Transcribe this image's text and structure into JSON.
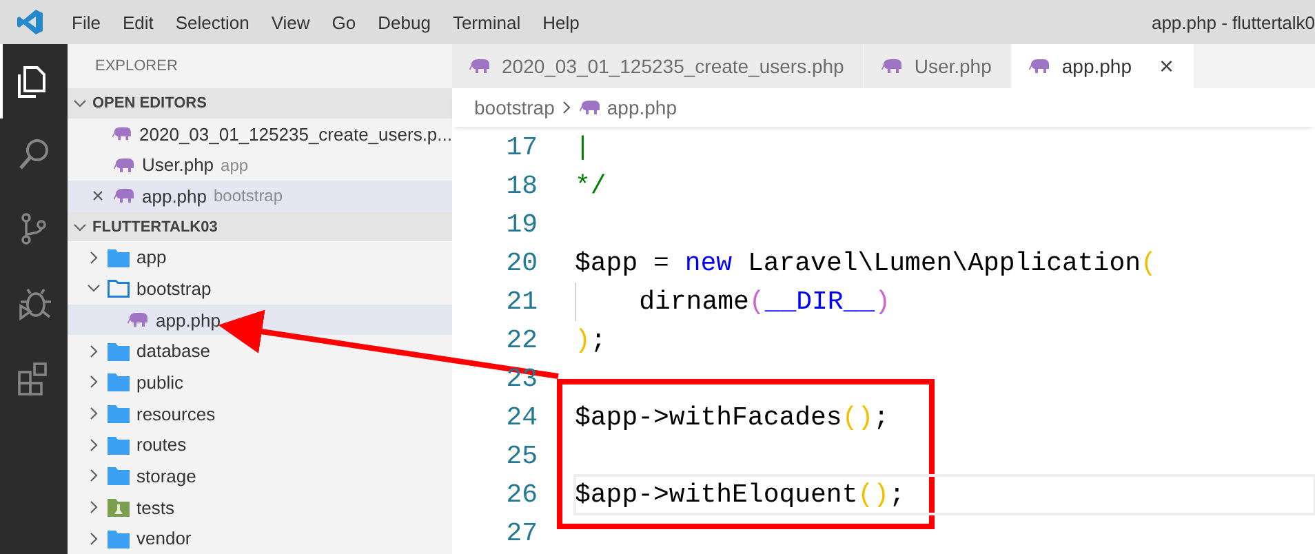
{
  "menu": [
    "File",
    "Edit",
    "Selection",
    "View",
    "Go",
    "Debug",
    "Terminal",
    "Help"
  ],
  "window": {
    "title": "app.php - fluttertalk0"
  },
  "activity_bar": [
    {
      "kind": "files",
      "selected": true
    },
    {
      "kind": "search",
      "selected": false
    },
    {
      "kind": "source-control",
      "selected": false
    },
    {
      "kind": "debug",
      "selected": false
    },
    {
      "kind": "extensions",
      "selected": false
    }
  ],
  "sidebar": {
    "title": "EXPLORER",
    "open_editors": {
      "label": "OPEN EDITORS",
      "expanded": true,
      "items": [
        {
          "label": "2020_03_01_125235_create_users.p...",
          "selected": false
        },
        {
          "label": "User.php",
          "description": "app",
          "selected": false
        },
        {
          "label": "app.php",
          "description": "bootstrap",
          "selected": true,
          "close": "×"
        }
      ]
    },
    "project": {
      "label": "FLUTTERTALK03",
      "expanded": true,
      "items": [
        {
          "label": "app",
          "kind": "folder",
          "expanded": false,
          "selected": false
        },
        {
          "label": "bootstrap",
          "kind": "folder",
          "expanded": true,
          "selected": false,
          "children": [
            {
              "label": "app.php",
              "kind": "php",
              "selected": true
            }
          ]
        },
        {
          "label": "database",
          "kind": "folder",
          "expanded": false,
          "selected": false
        },
        {
          "label": "public",
          "kind": "folder",
          "expanded": false,
          "selected": false
        },
        {
          "label": "resources",
          "kind": "folder",
          "expanded": false,
          "selected": false
        },
        {
          "label": "routes",
          "kind": "folder",
          "expanded": false,
          "selected": false
        },
        {
          "label": "storage",
          "kind": "folder",
          "expanded": false,
          "selected": false
        },
        {
          "label": "tests",
          "kind": "test-folder",
          "expanded": false,
          "selected": false
        },
        {
          "label": "vendor",
          "kind": "folder",
          "expanded": false,
          "selected": false
        }
      ]
    }
  },
  "tabs": [
    {
      "label": "2020_03_01_125235_create_users.php",
      "selected": false
    },
    {
      "label": "User.php",
      "selected": false
    },
    {
      "label": "app.php",
      "selected": true,
      "close": "×"
    }
  ],
  "breadcrumb": [
    "bootstrap",
    "app.php"
  ],
  "code": [
    {
      "number": "17",
      "current": false,
      "tokens": [
        {
          "kind": "comment",
          "text": "|"
        }
      ]
    },
    {
      "number": "18",
      "current": false,
      "tokens": [
        {
          "kind": "comment",
          "text": "*/"
        }
      ]
    },
    {
      "number": "19",
      "current": false
    },
    {
      "number": "20",
      "current": false,
      "tokens": [
        {
          "kind": "plain",
          "text": "$app = "
        },
        {
          "kind": "keyword",
          "text": "new"
        },
        {
          "kind": "plain",
          "text": " Laravel\\Lumen\\Application"
        },
        {
          "kind": "paren",
          "text": "("
        }
      ]
    },
    {
      "number": "21",
      "current": false,
      "tokens": [
        {
          "kind": "indent"
        },
        {
          "kind": "plain",
          "text": "dirname"
        },
        {
          "kind": "paren2",
          "text": "("
        },
        {
          "kind": "constant",
          "text": "__DIR__"
        },
        {
          "kind": "paren2",
          "text": ")"
        }
      ]
    },
    {
      "number": "22",
      "current": false,
      "tokens": [
        {
          "kind": "paren",
          "text": ")"
        },
        {
          "kind": "plain",
          "text": ";"
        }
      ]
    },
    {
      "number": "23",
      "current": false
    },
    {
      "number": "24",
      "current": false,
      "tokens": [
        {
          "kind": "plain",
          "text": "$app->withFacades"
        },
        {
          "kind": "paren",
          "text": "()"
        },
        {
          "kind": "plain",
          "text": ";"
        }
      ]
    },
    {
      "number": "25",
      "current": false
    },
    {
      "number": "26",
      "current": true,
      "tokens": [
        {
          "kind": "plain",
          "text": "$app->withEloquent"
        },
        {
          "kind": "paren",
          "text": "()"
        },
        {
          "kind": "plain",
          "text": ";"
        }
      ]
    },
    {
      "number": "27",
      "current": false
    }
  ]
}
